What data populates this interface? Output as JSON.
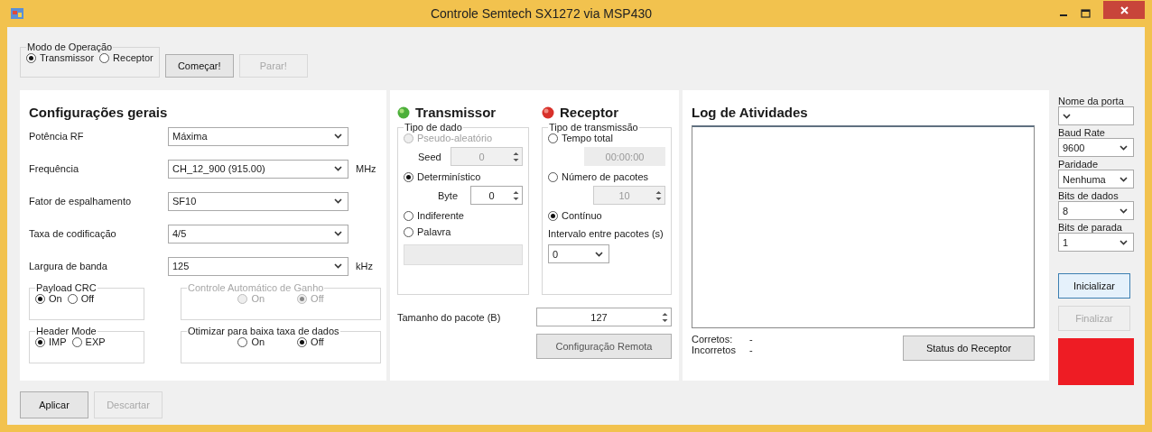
{
  "window": {
    "title": "Controle Semtech SX1272 via MSP430"
  },
  "operation_mode": {
    "label": "Modo de Operação",
    "options": [
      {
        "label": "Transmissor",
        "selected": true
      },
      {
        "label": "Receptor",
        "selected": false
      }
    ]
  },
  "top_buttons": [
    {
      "label": "Começar!",
      "disabled": false
    },
    {
      "label": "Parar!",
      "disabled": true
    }
  ],
  "general_settings": {
    "title": "Configurações gerais",
    "fields": [
      {
        "label": "Potência RF",
        "value": "Máxima"
      },
      {
        "label": "Frequência",
        "value": "CH_12_900 (915.00)",
        "unit": "MHz"
      },
      {
        "label": "Fator de espalhamento",
        "value": "SF10"
      },
      {
        "label": "Taxa de codificação",
        "value": "4/5"
      },
      {
        "label": "Largura de banda",
        "value": "125",
        "unit": "kHz"
      }
    ],
    "option_groups": [
      {
        "label": "Payload CRC",
        "disabled": false,
        "options": [
          {
            "label": "On",
            "selected": true
          },
          {
            "label": "Off",
            "selected": false
          }
        ]
      },
      {
        "label": "Controle Automático de Ganho",
        "disabled": true,
        "options": [
          {
            "label": "On",
            "selected": false
          },
          {
            "label": "Off",
            "selected": true
          }
        ]
      },
      {
        "label": "Header Mode",
        "disabled": false,
        "options": [
          {
            "label": "IMP",
            "selected": true
          },
          {
            "label": "EXP",
            "selected": false
          }
        ]
      },
      {
        "label": "Otimizar para baixa taxa de dados",
        "disabled": false,
        "options": [
          {
            "label": "On",
            "selected": false
          },
          {
            "label": "Off",
            "selected": true
          }
        ]
      }
    ]
  },
  "transmitter": {
    "title": "Transmissor",
    "led_on": true,
    "group": {
      "label": "Tipo de dado",
      "options": [
        {
          "label": "Pseudo-aleatório",
          "selected": false,
          "disabled": true,
          "sub": {
            "kind": "spinner",
            "label": "Seed",
            "value": "0",
            "disabled": true
          }
        },
        {
          "label": "Determinístico",
          "selected": true,
          "disabled": false,
          "sub": {
            "kind": "spinner",
            "label": "Byte",
            "value": "0",
            "disabled": false
          }
        },
        {
          "label": "Indiferente",
          "selected": false,
          "disabled": false
        },
        {
          "label": "Palavra",
          "selected": false,
          "disabled": false,
          "sub": {
            "kind": "field",
            "disabled": true
          }
        }
      ]
    }
  },
  "receiver": {
    "title": "Receptor",
    "led_on": false,
    "group": {
      "label": "Tipo de transmissão",
      "options": [
        {
          "label": "Tempo total",
          "selected": false,
          "disabled": false,
          "sub": {
            "kind": "text",
            "value": "00:00:00",
            "disabled": true
          }
        },
        {
          "label": "Número de pacotes",
          "selected": false,
          "disabled": false,
          "sub": {
            "kind": "spinner",
            "value": "10",
            "disabled": true
          }
        },
        {
          "label": "Contínuo",
          "selected": true,
          "disabled": false
        }
      ]
    },
    "interval": {
      "label": "Intervalo entre pacotes (s)",
      "value": "0"
    }
  },
  "packet_size": {
    "label": "Tamanho do pacote (B)",
    "value": "127"
  },
  "remote_config_button": {
    "label": "Configuração Remota",
    "disabled": false
  },
  "log": {
    "title": "Log de Atividades",
    "stats": [
      {
        "label": "Corretos:",
        "value": "-"
      },
      {
        "label": "Incorretos",
        "value": "-"
      }
    ],
    "status_button": "Status do Receptor"
  },
  "serial": {
    "fields": [
      {
        "label": "Nome da porta"
      },
      {
        "label": "Baud Rate",
        "value": "9600"
      },
      {
        "label": "Paridade",
        "value": "Nenhuma"
      },
      {
        "label": "Bits de dados",
        "value": "8"
      },
      {
        "label": "Bits de parada",
        "value": "1"
      }
    ],
    "buttons": [
      {
        "label": "Inicializar",
        "disabled": false,
        "focused": true
      },
      {
        "label": "Finalizar",
        "disabled": true,
        "focused": false
      }
    ],
    "connected": false
  },
  "bottom_buttons": [
    {
      "label": "Aplicar",
      "disabled": false
    },
    {
      "label": "Descartar",
      "disabled": true
    }
  ]
}
